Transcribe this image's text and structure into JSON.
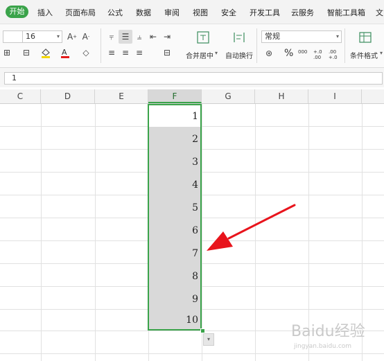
{
  "menu": {
    "active": "开始",
    "items": [
      "插入",
      "页面布局",
      "公式",
      "数据",
      "审阅",
      "视图",
      "安全",
      "开发工具",
      "云服务",
      "智能工具箱",
      "文"
    ]
  },
  "ribbon": {
    "font_size": "16",
    "merge_label": "合并居中",
    "wrap_label": "自动换行",
    "number_format": "常规",
    "percent": "%",
    "thousands": "000",
    "inc_decimal": "+.0 .00",
    "dec_decimal": ".00 +.0",
    "cond_format": "条件格式"
  },
  "formula_bar": {
    "value": "1"
  },
  "columns": [
    "C",
    "D",
    "E",
    "F",
    "G",
    "H",
    "I"
  ],
  "selected_column": "F",
  "cells": [
    "1",
    "2",
    "3",
    "4",
    "5",
    "6",
    "7",
    "8",
    "9",
    "10"
  ],
  "watermark": {
    "logo": "Baidu经验",
    "url": "jingyan.baidu.com"
  },
  "colors": {
    "accent": "#3aa34a",
    "arrow": "#e8141c",
    "selection_fill": "#d9d9d9"
  }
}
